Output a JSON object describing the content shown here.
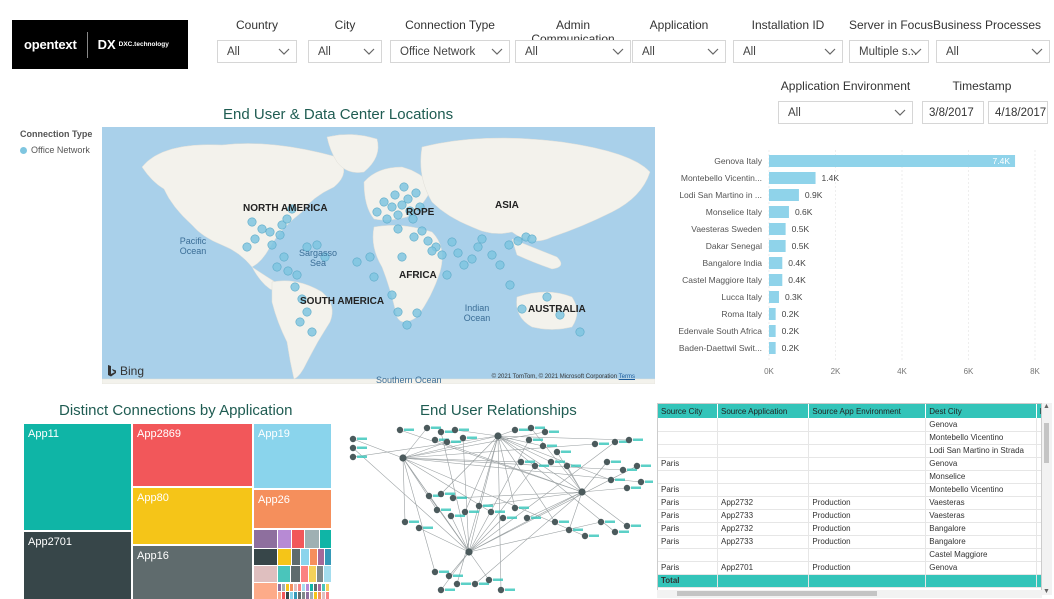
{
  "logo": {
    "opentext": "opentext",
    "dxc_mark": "DX",
    "dxc": "DXC.technology"
  },
  "slicers": [
    {
      "label": "Country",
      "value": "All"
    },
    {
      "label": "City",
      "value": "All"
    },
    {
      "label": "Connection Type",
      "value": "Office Network"
    },
    {
      "label": "Admin Communication",
      "value": "All"
    },
    {
      "label": "Application",
      "value": "All"
    },
    {
      "label": "Installation ID",
      "value": "All"
    },
    {
      "label": "Server in Focus",
      "value": "Multiple s..."
    },
    {
      "label": "Business Processes",
      "value": "All"
    }
  ],
  "app_env": {
    "label": "Application Environment",
    "value": "All"
  },
  "timestamp": {
    "label": "Timestamp",
    "start": "3/8/2017",
    "end": "4/18/2017"
  },
  "map": {
    "title": "End User & Data Center Locations",
    "legend_title": "Connection Type",
    "legend_item": "Office Network",
    "labels": {
      "north_america": "NORTH AMERICA",
      "europe": "ROPE",
      "asia": "ASIA",
      "africa": "AFRICA",
      "south_america": "SOUTH AMERICA",
      "australia": "AUSTRALIA",
      "pacific": "Pacific Ocean",
      "sargasso": "Sargasso Sea",
      "indian": "Indian Ocean",
      "southern": "Southern Ocean"
    },
    "bing": "Bing",
    "copyright": "© 2021 TomTom, © 2021 Microsoft Corporation",
    "terms": "Terms",
    "colors": {
      "water": "#a9d0ea",
      "land": "#f3f2ec",
      "point": "#7fc6e0"
    }
  },
  "chart_data": {
    "type": "bar",
    "orientation": "horizontal",
    "categories": [
      "Genova Italy",
      "Montebello Vicentin...",
      "Lodi San Martino in ...",
      "Monselice Italy",
      "Vaesteras Sweden",
      "Dakar Senegal",
      "Bangalore India",
      "Castel Maggiore Italy",
      "Lucca Italy",
      "Roma Italy",
      "Edenvale South Africa",
      "Baden-Daettwil Swit..."
    ],
    "values": [
      7400,
      1400,
      900,
      600,
      500,
      500,
      400,
      400,
      300,
      200,
      200,
      200
    ],
    "data_labels": [
      "7.4K",
      "1.4K",
      "0.9K",
      "0.6K",
      "0.5K",
      "0.5K",
      "0.4K",
      "0.4K",
      "0.3K",
      "0.2K",
      "0.2K",
      "0.2K"
    ],
    "xlim": [
      0,
      8000
    ],
    "x_ticks": [
      "0K",
      "2K",
      "4K",
      "6K",
      "8K"
    ],
    "x_tick_values": [
      0,
      2000,
      4000,
      6000,
      8000
    ],
    "bar_color": "#8fd3ea",
    "grid": true
  },
  "treemap": {
    "title": "Distinct Connections by Application",
    "apps": [
      "App11",
      "App2869",
      "App19",
      "App80",
      "App26",
      "App2701",
      "App16"
    ],
    "colors": {
      "App11": "#0fb5a6",
      "App2869": "#f2575a",
      "App19": "#8ad4ec",
      "App80": "#f5c518",
      "App26": "#f58f5c",
      "App2701": "#374649",
      "App16": "#5f6b6d"
    }
  },
  "network": {
    "title": "End User Relationships"
  },
  "table": {
    "headers": [
      "Source City",
      "Source Application",
      "Source App Environment",
      "Dest City",
      "D"
    ],
    "rows": [
      [
        "",
        "",
        "",
        "Genova",
        ""
      ],
      [
        "",
        "",
        "",
        "Montebello Vicentino",
        ""
      ],
      [
        "",
        "",
        "",
        "Lodi San Martino in Strada",
        ""
      ],
      [
        "Paris",
        "",
        "",
        "Genova",
        ""
      ],
      [
        "",
        "",
        "",
        "Monselice",
        ""
      ],
      [
        "Paris",
        "",
        "",
        "Montebello Vicentino",
        ""
      ],
      [
        "Paris",
        "App2732",
        "Production",
        "Vaesteras",
        ""
      ],
      [
        "Paris",
        "App2733",
        "Production",
        "Vaesteras",
        ""
      ],
      [
        "Paris",
        "App2732",
        "Production",
        "Bangalore",
        ""
      ],
      [
        "Paris",
        "App2733",
        "Production",
        "Bangalore",
        ""
      ],
      [
        "",
        "",
        "",
        "Castel Maggiore",
        ""
      ],
      [
        "Paris",
        "App2701",
        "Production",
        "Genova",
        ""
      ]
    ],
    "total_label": "Total"
  }
}
